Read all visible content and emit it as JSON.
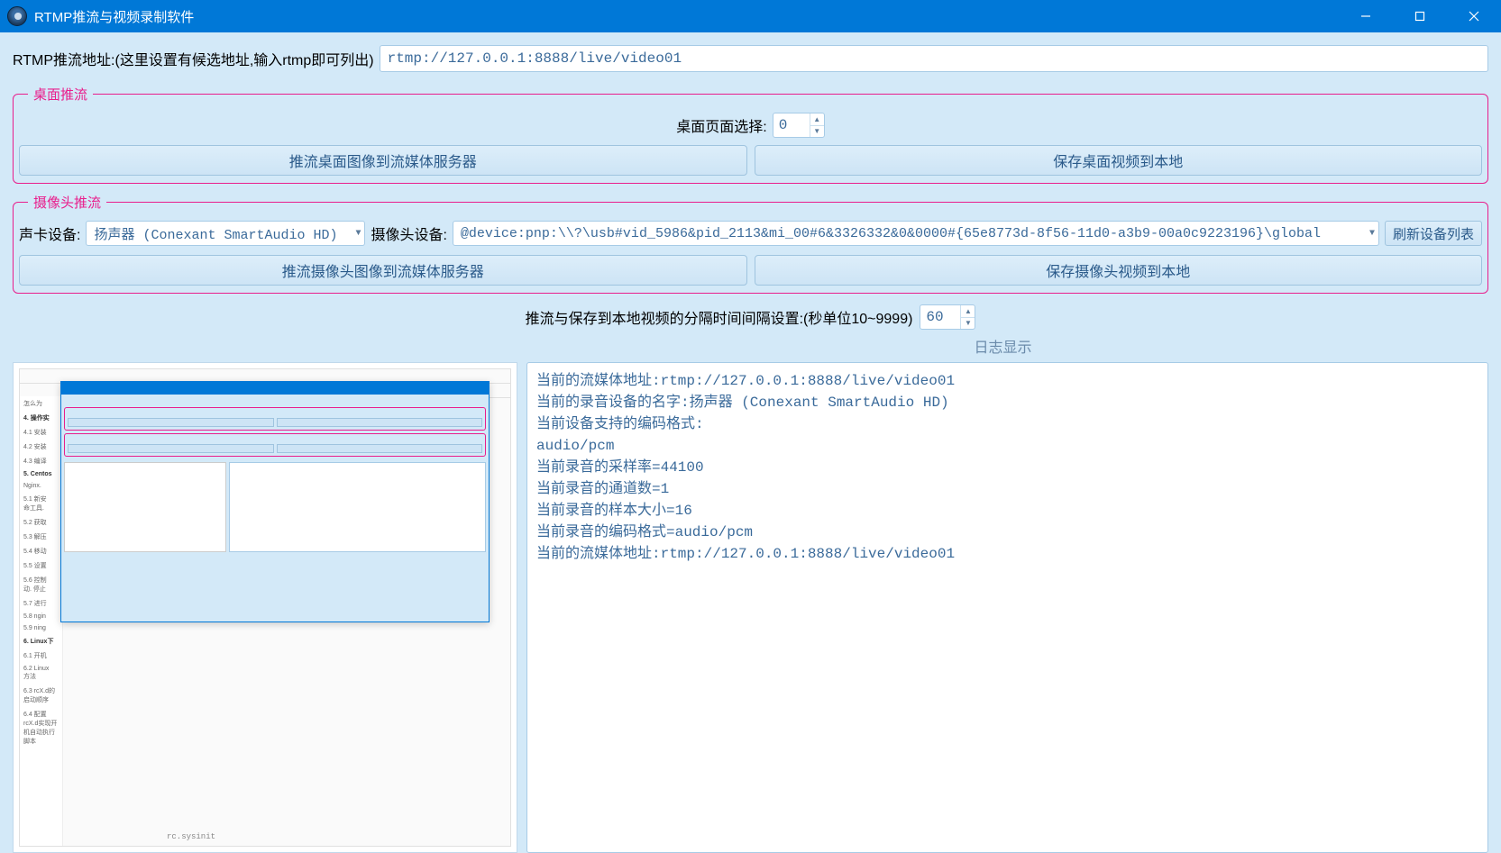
{
  "window": {
    "title": "RTMP推流与视频录制软件"
  },
  "url_row": {
    "label": "RTMP推流地址:(这里设置有候选地址,输入rtmp即可列出)",
    "value": "rtmp://127.0.0.1:8888/live/video01"
  },
  "desktop_group": {
    "legend": "桌面推流",
    "page_label": "桌面页面选择:",
    "page_value": "0",
    "push_btn": "推流桌面图像到流媒体服务器",
    "save_btn": "保存桌面视频到本地"
  },
  "camera_group": {
    "legend": "摄像头推流",
    "audio_label": "声卡设备:",
    "audio_value": "扬声器 (Conexant SmartAudio HD)",
    "camera_label": "摄像头设备:",
    "camera_value": "@device:pnp:\\\\?\\usb#vid_5986&pid_2113&mi_00#6&3326332&0&0000#{65e8773d-8f56-11d0-a3b9-00a0c9223196}\\global",
    "refresh_btn": "刷新设备列表",
    "push_btn": "推流摄像头图像到流媒体服务器",
    "save_btn": "保存摄像头视频到本地"
  },
  "interval": {
    "label": "推流与保存到本地视频的分隔时间间隔设置:(秒单位10~9999)",
    "value": "60"
  },
  "log_title": "日志显示",
  "log_lines": [
    "当前的流媒体地址:rtmp://127.0.0.1:8888/live/video01",
    "当前的录音设备的名字:扬声器 (Conexant SmartAudio HD)",
    "当前设备支持的编码格式:",
    "audio/pcm",
    "当前录音的采样率=44100",
    "当前录音的通道数=1",
    "当前录音的样本大小=16",
    "当前录音的编码格式=audio/pcm",
    "当前的流媒体地址:rtmp://127.0.0.1:8888/live/video01"
  ],
  "preview": {
    "bottom_text": "rc.sysinit"
  }
}
